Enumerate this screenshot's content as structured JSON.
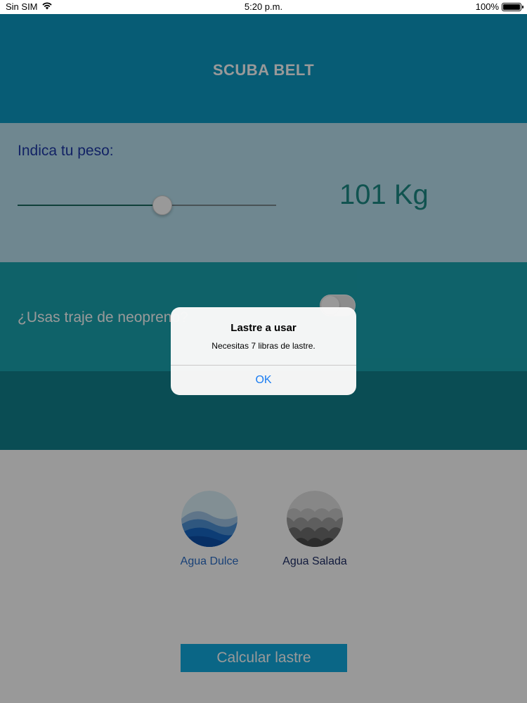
{
  "status_bar": {
    "carrier": "Sin SIM",
    "time": "5:20 p.m.",
    "battery": "100%"
  },
  "header": {
    "title": "SCUBA BELT"
  },
  "weight": {
    "label": "Indica tu peso:",
    "value_text": "101 Kg",
    "slider_fraction": 0.56
  },
  "neoprene": {
    "label": "¿Usas traje de neopreno?",
    "enabled": false
  },
  "water": {
    "fresh_label": "Agua Dulce",
    "salt_label": "Agua Salada"
  },
  "actions": {
    "calculate_label": "Calcular lastre"
  },
  "alert": {
    "title": "Lastre a usar",
    "message": "Necesitas 7 libras de lastre.",
    "ok_label": "OK"
  },
  "colors": {
    "header": "#0d99c4",
    "weight_bg": "#b9e2f0",
    "neoprene_bg": "#19a3b0",
    "dark_band": "#11808c",
    "button": "#12aadf",
    "alert_link": "#1a7df2"
  }
}
